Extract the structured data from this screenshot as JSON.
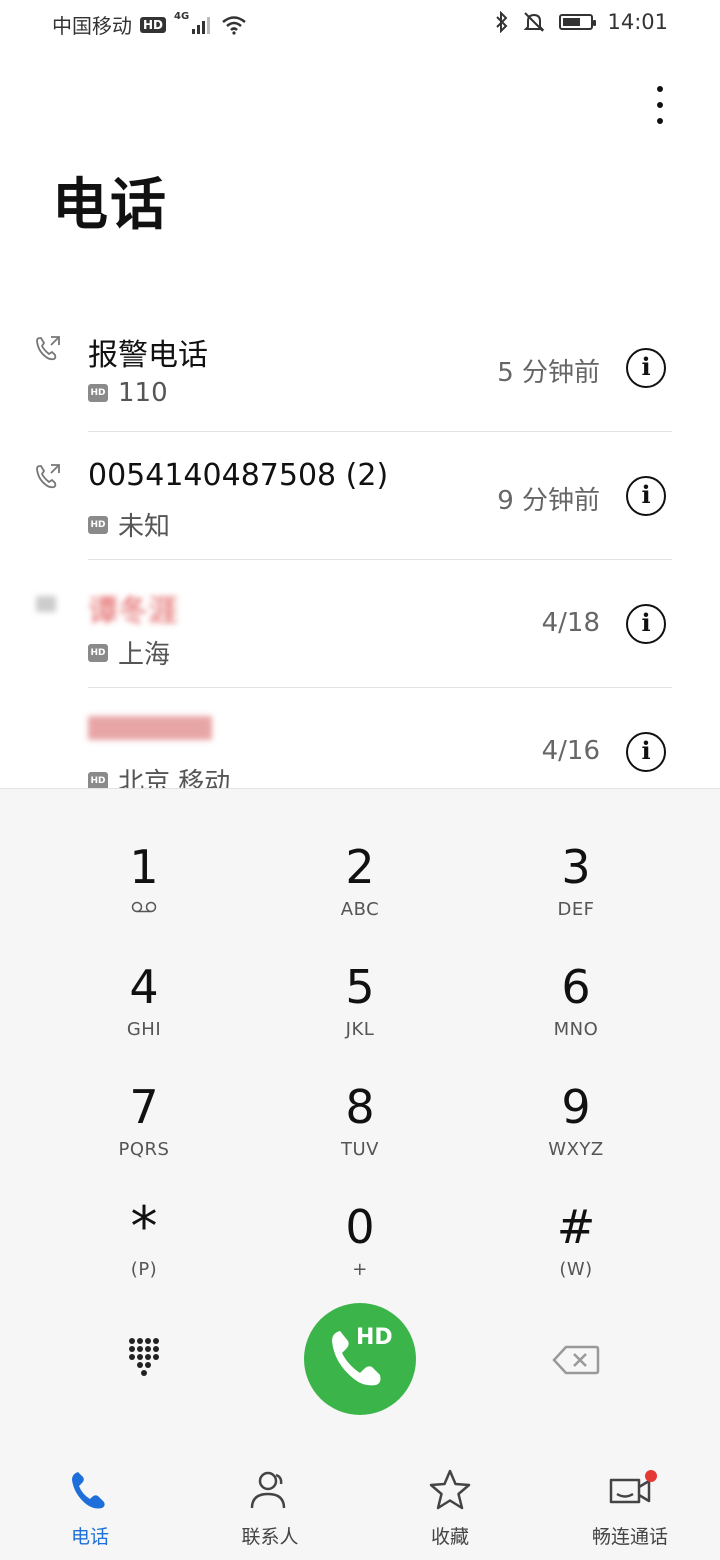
{
  "status_bar": {
    "carrier": "中国移动",
    "hd": "HD",
    "network": "4G",
    "time": "14:01",
    "battery_level": 0.55
  },
  "header": {
    "title": "电话"
  },
  "call_log": [
    {
      "name": "报警电话",
      "subtitle": "110",
      "time": "5 分钟前",
      "blurred": false
    },
    {
      "name": "0054140487508 (2)",
      "subtitle": "未知",
      "time": "9 分钟前",
      "blurred": false
    },
    {
      "name": "谭冬涯",
      "subtitle": "上海",
      "time": "4/18",
      "blurred": true
    },
    {
      "name": "",
      "subtitle": "北京 移动",
      "time": "4/16",
      "blurred": true
    }
  ],
  "dialpad": {
    "keys": [
      {
        "digit": "1",
        "letters": ""
      },
      {
        "digit": "2",
        "letters": "ABC"
      },
      {
        "digit": "3",
        "letters": "DEF"
      },
      {
        "digit": "4",
        "letters": "GHI"
      },
      {
        "digit": "5",
        "letters": "JKL"
      },
      {
        "digit": "6",
        "letters": "MNO"
      },
      {
        "digit": "7",
        "letters": "PQRS"
      },
      {
        "digit": "8",
        "letters": "TUV"
      },
      {
        "digit": "9",
        "letters": "WXYZ"
      },
      {
        "digit": "*",
        "letters": "(P)"
      },
      {
        "digit": "0",
        "letters": "+"
      },
      {
        "digit": "#",
        "letters": "(W)"
      }
    ],
    "call_button_label": "HD"
  },
  "bottom_nav": {
    "items": [
      {
        "label": "电话",
        "icon": "phone-icon",
        "active": true
      },
      {
        "label": "联系人",
        "icon": "contacts-icon",
        "active": false
      },
      {
        "label": "收藏",
        "icon": "star-icon",
        "active": false
      },
      {
        "label": "畅连通话",
        "icon": "video-call-icon",
        "active": false
      }
    ]
  },
  "colors": {
    "accent": "#1e6fd9",
    "call_green": "#3bb54a",
    "notification_red": "#e53935"
  }
}
